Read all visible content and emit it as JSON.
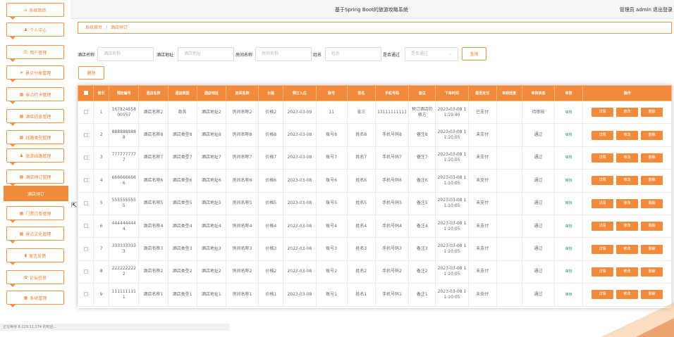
{
  "app": {
    "title": "基于Spring Boot的旅游攻略系统",
    "user": "管理员 admin",
    "logout": "退出登录"
  },
  "sidebar": {
    "items": [
      {
        "label": "系统首页",
        "icon": "home-icon",
        "glyph": "⌂"
      },
      {
        "label": "个人中心",
        "icon": "user-icon",
        "glyph": "♟"
      },
      {
        "label": "用户管理",
        "icon": "list-icon",
        "glyph": "☰"
      },
      {
        "label": "景点分类管理",
        "icon": "send-icon",
        "glyph": "➤"
      },
      {
        "label": "景点打卡管理",
        "icon": "grid-icon",
        "glyph": "▦"
      },
      {
        "label": "酒店信息管理",
        "icon": "grid-icon",
        "glyph": "▦"
      },
      {
        "label": "线路类型管理",
        "icon": "grid-icon",
        "glyph": "▦"
      },
      {
        "label": "旅游线路管理",
        "icon": "user-icon",
        "glyph": "♟"
      },
      {
        "label": "酒店预订管理",
        "icon": "grid-icon",
        "glyph": "▦"
      },
      {
        "label": "门票订单管理",
        "icon": "grid-icon",
        "glyph": "▦"
      },
      {
        "label": "景点文化管理",
        "icon": "grid-icon",
        "glyph": "▦"
      },
      {
        "label": "留言反馈",
        "icon": "chart-icon",
        "glyph": "▮"
      },
      {
        "label": "论坛信息",
        "icon": "settings-icon",
        "glyph": "✿"
      },
      {
        "label": "系统管理",
        "icon": "grid-icon",
        "glyph": "▦"
      }
    ],
    "active_submenu": "酒店预订",
    "status_text": "正在等待 8.129.11.174 的响应..."
  },
  "breadcrumb": {
    "home": "系统首页",
    "sep": "/",
    "current": "酒店预订"
  },
  "search": {
    "fields": [
      {
        "label": "酒店名称",
        "placeholder": "酒店名称"
      },
      {
        "label": "酒店地址",
        "placeholder": "酒店地址"
      },
      {
        "label": "房间名称",
        "placeholder": "房间名称"
      },
      {
        "label": "姓名",
        "placeholder": "姓名"
      }
    ],
    "select_label": "是否通过",
    "select_placeholder": "是否通过",
    "query_button": "查询"
  },
  "actions": {
    "delete_button": "删除"
  },
  "table": {
    "headers": [
      "索引",
      "预定编号",
      "酒店名称",
      "酒店类型",
      "酒店地址",
      "房间名称",
      "价格",
      "预订入住",
      "账号",
      "姓名",
      "手机号码",
      "备注",
      "下单时间",
      "是否支付",
      "审核回复",
      "审核状态",
      "审核",
      "操作"
    ],
    "ops": [
      "详情",
      "修改",
      "删除"
    ],
    "audit_label": "审核",
    "rows": [
      [
        "1",
        "16782455800557",
        "酒店名称2",
        "商务",
        "酒店地址2",
        "房间名称2",
        "价格2",
        "2023-03-09",
        "11",
        "张三",
        "13111111111",
        "预订酒店的格方",
        "2023-03-08 11:19:40",
        "已支付",
        "",
        "待审核"
      ],
      [
        "2",
        "8888888888",
        "酒店名称8",
        "酒店类型8",
        "酒店地址8",
        "房间名称8",
        "价格8",
        "2023-03-08",
        "账号8",
        "姓名8",
        "手机号码8",
        "备注8",
        "2023-03-08 11:10:05",
        "未支付",
        "",
        "通过"
      ],
      [
        "3",
        "7777777777",
        "酒店名称7",
        "酒店类型7",
        "酒店地址7",
        "房间名称7",
        "价格7",
        "2023-03-08",
        "账号7",
        "姓名7",
        "手机号码7",
        "备注7",
        "2023-03-08 11:10:05",
        "未支付",
        "",
        "通过"
      ],
      [
        "4",
        "6666666666",
        "酒店名称6",
        "酒店类型6",
        "酒店地址6",
        "房间名称6",
        "价格6",
        "2023-03-08",
        "账号6",
        "姓名6",
        "手机号码6",
        "备注6",
        "2023-03-08 11:10:05",
        "未支付",
        "",
        "通过"
      ],
      [
        "5",
        "5555555555",
        "酒店名称5",
        "酒店类型5",
        "酒店地址5",
        "房间名称5",
        "价格5",
        "2023-03-08",
        "账号5",
        "姓名5",
        "手机号码5",
        "备注5",
        "2023-03-08 11:10:05",
        "未支付",
        "",
        "通过"
      ],
      [
        "6",
        "4444444444",
        "酒店名称4",
        "酒店类型4",
        "酒店地址4",
        "房间名称4",
        "价格4",
        "2023-03-08",
        "账号4",
        "姓名4",
        "手机号码4",
        "备注4",
        "2023-03-08 11:10:05",
        "未支付",
        "",
        "通过"
      ],
      [
        "7",
        "3333333333",
        "酒店名称3",
        "酒店类型3",
        "酒店地址3",
        "房间名称3",
        "价格3",
        "2023-03-08",
        "账号3",
        "姓名3",
        "手机号码3",
        "备注3",
        "2023-03-08 11:10:05",
        "未支付",
        "",
        "通过"
      ],
      [
        "8",
        "2222222222",
        "酒店名称2",
        "酒店类型2",
        "酒店地址2",
        "房间名称2",
        "价格2",
        "2023-03-08",
        "账号2",
        "姓名2",
        "手机号码2",
        "备注2",
        "2023-03-08 11:10:05",
        "未支付",
        "",
        "通过"
      ],
      [
        "9",
        "1111111111",
        "酒店名称1",
        "酒店类型1",
        "酒店地址1",
        "房间名称1",
        "价格1",
        "2023-03-08",
        "账号1",
        "姓名1",
        "手机号码1",
        "备注1",
        "2023-03-08 11:10:05",
        "未支付",
        "",
        "通过"
      ]
    ]
  },
  "colors": {
    "accent": "#f28a3c",
    "audit_link": "#2aa05a",
    "border": "#f19349"
  }
}
